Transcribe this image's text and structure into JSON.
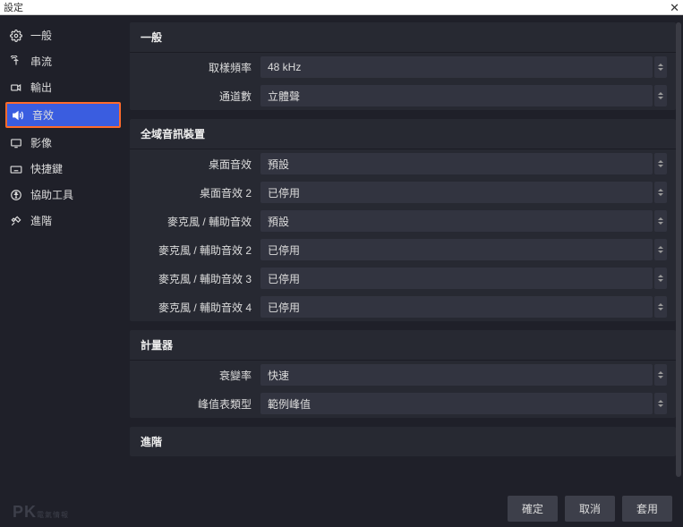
{
  "window": {
    "title": "設定"
  },
  "sidebar": {
    "items": [
      {
        "label": "一般"
      },
      {
        "label": "串流"
      },
      {
        "label": "輸出"
      },
      {
        "label": "音效"
      },
      {
        "label": "影像"
      },
      {
        "label": "快捷鍵"
      },
      {
        "label": "協助工具"
      },
      {
        "label": "進階"
      }
    ]
  },
  "groups": {
    "general": {
      "title": "一般",
      "rows": [
        {
          "label": "取樣頻率",
          "value": "48 kHz"
        },
        {
          "label": "通道數",
          "value": "立體聲"
        }
      ]
    },
    "devices": {
      "title": "全域音訊裝置",
      "rows": [
        {
          "label": "桌面音效",
          "value": "預設"
        },
        {
          "label": "桌面音效 2",
          "value": "已停用"
        },
        {
          "label": "麥克風 / 輔助音效",
          "value": "預設"
        },
        {
          "label": "麥克風 / 輔助音效 2",
          "value": "已停用"
        },
        {
          "label": "麥克風 / 輔助音效 3",
          "value": "已停用"
        },
        {
          "label": "麥克風 / 輔助音效 4",
          "value": "已停用"
        }
      ]
    },
    "meters": {
      "title": "計量器",
      "rows": [
        {
          "label": "衰變率",
          "value": "快速"
        },
        {
          "label": "峰值表類型",
          "value": "範例峰值"
        }
      ]
    },
    "advanced": {
      "title": "進階"
    }
  },
  "footer": {
    "ok": "確定",
    "cancel": "取消",
    "apply": "套用"
  },
  "watermark": {
    "main": "PK",
    "sub": "電氣情報"
  }
}
